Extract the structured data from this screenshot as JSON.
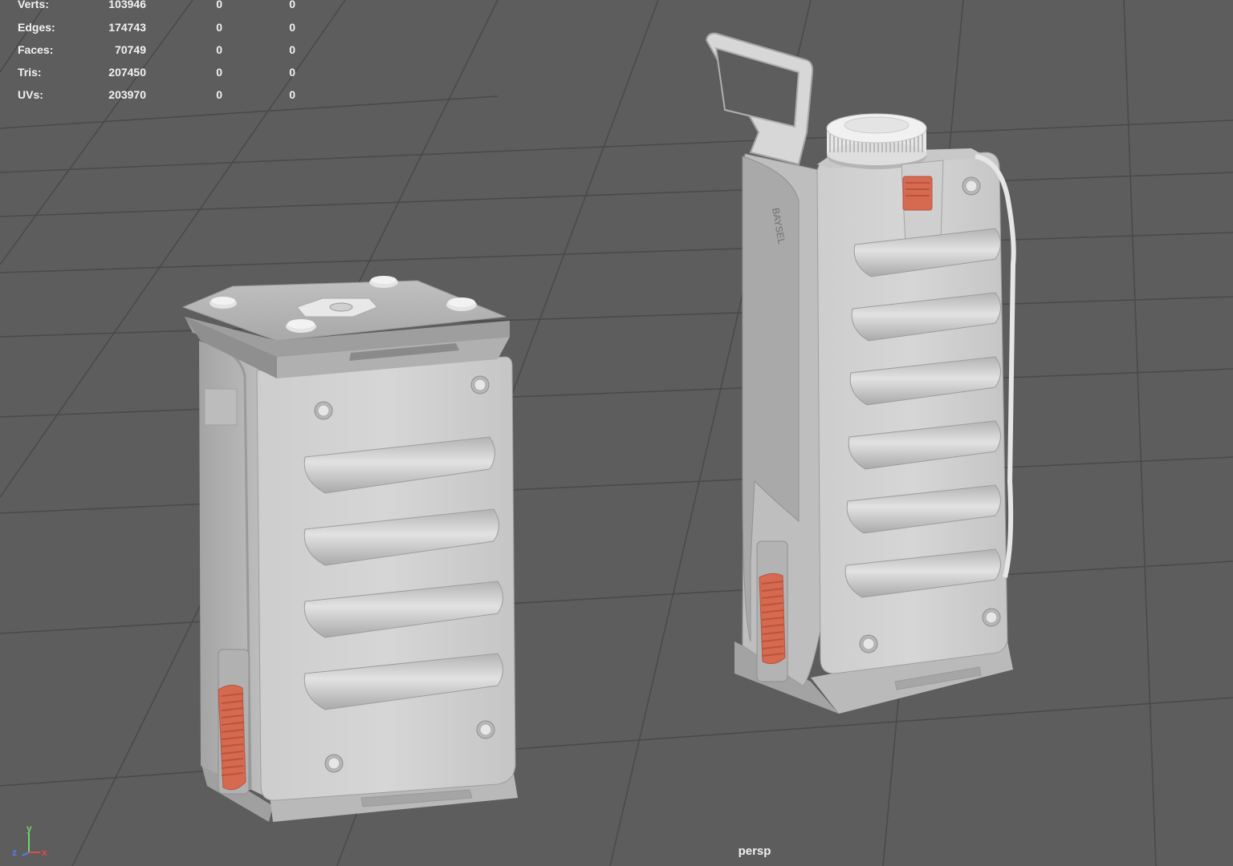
{
  "hud": {
    "rows": [
      {
        "label": "Verts:",
        "total": "103946",
        "selected": "0",
        "extra": "0"
      },
      {
        "label": "Edges:",
        "total": "174743",
        "selected": "0",
        "extra": "0"
      },
      {
        "label": "Faces:",
        "total": "70749",
        "selected": "0",
        "extra": "0"
      },
      {
        "label": "Tris:",
        "total": "207450",
        "selected": "0",
        "extra": "0"
      },
      {
        "label": "UVs:",
        "total": "203970",
        "selected": "0",
        "extra": "0"
      }
    ]
  },
  "viewport": {
    "camera": "persp",
    "background_color": "#5d5d5d",
    "grid_color": "#474747",
    "model_color": "#c9c9c9",
    "accent_color": "#d8684f"
  },
  "axes": {
    "y": "y",
    "z": "z",
    "x": "x",
    "y_color": "#6ed36e",
    "z_color": "#5a7cf0",
    "x_color": "#e04a4a"
  },
  "models": {
    "left": {
      "name": "battery-box-closed"
    },
    "right": {
      "name": "battery-box-with-handle",
      "engraving": "BAYSEL"
    }
  }
}
